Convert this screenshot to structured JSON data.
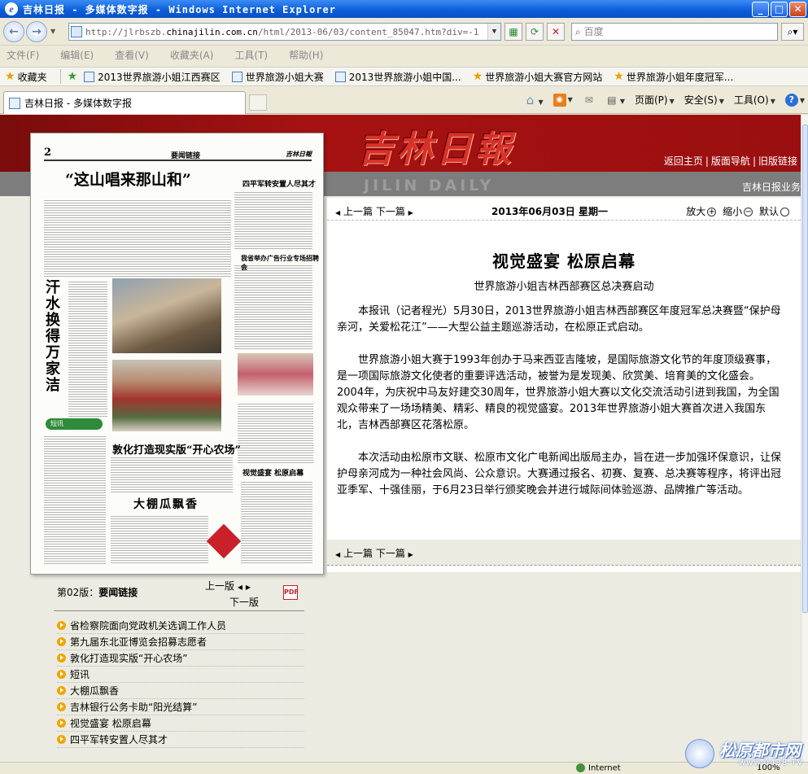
{
  "window": {
    "title": "吉林日报 - 多媒体数字报 - Windows Internet Explorer"
  },
  "address": {
    "url_prefix": "http://jlrbszb.",
    "url_host": "chinajilin.com.cn",
    "url_path": "/html/2013-06/03/content_85047.htm?div=-1"
  },
  "search": {
    "placeholder": "百度"
  },
  "menu": [
    "文件(F)",
    "编辑(E)",
    "查看(V)",
    "收藏夹(A)",
    "工具(T)",
    "帮助(H)"
  ],
  "favorites": {
    "label": "收藏夹",
    "items": [
      "2013世界旅游小姐江西赛区",
      "世界旅游小姐大赛",
      "2013世界旅游小姐中国...",
      "世界旅游小姐大赛官方网站",
      "世界旅游小姐年度冠军..."
    ]
  },
  "tab": {
    "title": "吉林日报 - 多媒体数字报"
  },
  "commands": {
    "page": "页面(P)",
    "safety": "安全(S)",
    "tools": "工具(O)"
  },
  "site": {
    "logo": "吉林日報",
    "english": "JILIN DAILY",
    "links": [
      "返回主页",
      "版面导航",
      "旧版链接"
    ],
    "band_right": "吉林日报业务"
  },
  "paper": {
    "page_no": "2",
    "section": "要闻链接",
    "brand": "吉林日報",
    "headline": "“这山唱来那山和”",
    "vertical": "汗水换得万家洁",
    "head2": "敦化打造现实版“开心农场”",
    "head3": "大棚瓜飘香",
    "head4": "四平军转安置人尽其才",
    "head5": "我省举办广告行业专场招聘会",
    "head6": "视觉盛宴 松原启幕",
    "duan": "短讯"
  },
  "edition": {
    "label": "第02版：",
    "name": "要闻链接",
    "prev": "上一版",
    "next": "下一版",
    "pdf": "PDF"
  },
  "articles": [
    "省检察院面向党政机关选调工作人员",
    "第九届东北亚博览会招募志愿者",
    "敦化打造现实版“开心农场”",
    "短讯",
    "大棚瓜飘香",
    "吉林银行公务卡助“阳光结算”",
    "视觉盛宴 松原启幕",
    "四平军转安置人尽其才"
  ],
  "article": {
    "prev": "上一篇",
    "next": "下一篇",
    "date": "2013年06月03日  星期一",
    "zoom_in": "放大",
    "zoom_out": "缩小",
    "zoom_default": "默认",
    "title": "视觉盛宴  松原启幕",
    "subtitle": "世界旅游小姐吉林西部赛区总决赛启动",
    "paragraphs": [
      "本报讯（记者程光）5月30日，2013世界旅游小姐吉林西部赛区年度冠军总决赛暨“保护母亲河，关爱松花江”——大型公益主题巡游活动，在松原正式启动。",
      "世界旅游小姐大赛于1993年创办于马来西亚吉隆坡，是国际旅游文化节的年度顶级赛事，是一项国际旅游文化使者的重要评选活动，被誉为是发现美、欣赏美、培育美的文化盛会。2004年，为庆祝中马友好建交30周年，世界旅游小姐大赛以文化交流活动引进到我国，为全国观众带来了一场场精美、精彩、精良的视觉盛宴。2013年世界旅游小姐大赛首次进入我国东北，吉林西部赛区花落松原。",
      "本次活动由松原市文联、松原市文化广电新闻出版局主办，旨在进一步加强环保意识，让保护母亲河成为一种社会风尚、公众意识。大赛通过报名、初赛、复赛、总决赛等程序，将评出冠亚季军、十强佳丽，于6月23日举行颁奖晚会并进行城际间体验巡游、品牌推广等活动。"
    ]
  },
  "status": {
    "zone": "Internet",
    "zoom": "100%"
  },
  "watermark": {
    "text": "松原都市网",
    "url": "www.0438.TV"
  }
}
